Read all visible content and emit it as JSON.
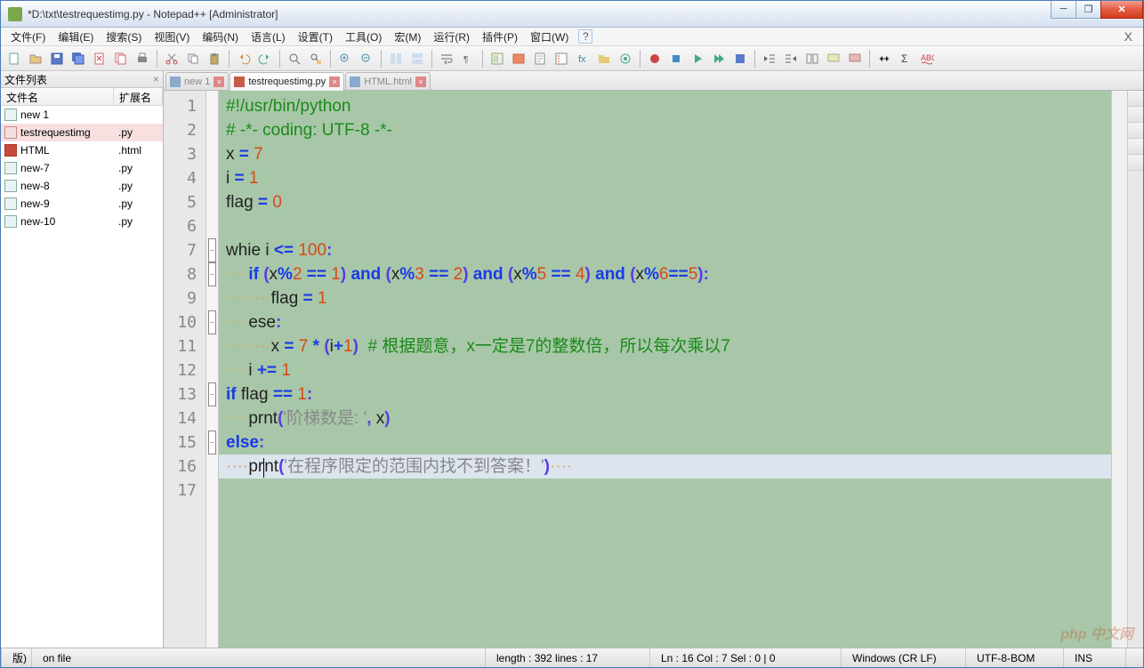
{
  "window": {
    "title": "*D:\\txt\\testrequestimg.py - Notepad++ [Administrator]"
  },
  "menus": [
    "文件(F)",
    "编辑(E)",
    "搜索(S)",
    "视图(V)",
    "编码(N)",
    "语言(L)",
    "设置(T)",
    "工具(O)",
    "宏(M)",
    "运行(R)",
    "插件(P)",
    "窗口(W)"
  ],
  "sidebar": {
    "title": "文件列表",
    "columns": {
      "name": "文件名",
      "ext": "扩展名"
    },
    "files": [
      {
        "name": "new 1",
        "ext": "",
        "kind": "plain"
      },
      {
        "name": "testrequestimg",
        "ext": ".py",
        "kind": "active"
      },
      {
        "name": "HTML",
        "ext": ".html",
        "kind": "html"
      },
      {
        "name": "new-7",
        "ext": ".py",
        "kind": "plain"
      },
      {
        "name": "new-8",
        "ext": ".py",
        "kind": "plain"
      },
      {
        "name": "new-9",
        "ext": ".py",
        "kind": "plain"
      },
      {
        "name": "new-10",
        "ext": ".py",
        "kind": "plain"
      }
    ]
  },
  "tabs": [
    {
      "label": "new 1",
      "active": false
    },
    {
      "label": "testrequestimg.py",
      "active": true
    },
    {
      "label": "HTML.html",
      "active": false
    }
  ],
  "code": {
    "lines": [
      {
        "n": 1,
        "fold": "",
        "html": "<span class='tok-comment'>#!/usr/bin/python</span>"
      },
      {
        "n": 2,
        "fold": "",
        "html": "<span class='tok-comment'># -*- coding: UTF-8 -*-</span>"
      },
      {
        "n": 3,
        "fold": "",
        "html": "<span class='tok-ident'>x</span> <span class='tok-op'>=</span> <span class='tok-num'>7</span>"
      },
      {
        "n": 4,
        "fold": "",
        "html": "<span class='tok-ident'>i</span> <span class='tok-op'>=</span> <span class='tok-num'>1</span>"
      },
      {
        "n": 5,
        "fold": "",
        "html": "<span class='tok-ident'>flag</span> <span class='tok-op'>=</span> <span class='tok-num'>0</span>"
      },
      {
        "n": 6,
        "fold": "",
        "html": ""
      },
      {
        "n": 7,
        "fold": "-",
        "html": "<span class='tok-ident'>whie</span> <span class='tok-ident'>i</span> <span class='tok-op'>&lt;=</span> <span class='tok-num'>100</span><span class='tok-paren'>:</span>"
      },
      {
        "n": 8,
        "fold": "-",
        "html": "<span class='ws'>····</span><span class='tok-keyword'>if</span> <span class='tok-paren'>(</span><span class='tok-ident'>x</span><span class='tok-op'>%</span><span class='tok-num'>2</span> <span class='tok-op'>==</span> <span class='tok-num'>1</span><span class='tok-paren'>)</span> <span class='tok-keyword'>and</span> <span class='tok-paren'>(</span><span class='tok-ident'>x</span><span class='tok-op'>%</span><span class='tok-num'>3</span> <span class='tok-op'>==</span> <span class='tok-num'>2</span><span class='tok-paren'>)</span> <span class='tok-keyword'>and</span> <span class='tok-paren'>(</span><span class='tok-ident'>x</span><span class='tok-op'>%</span><span class='tok-num'>5</span> <span class='tok-op'>==</span> <span class='tok-num'>4</span><span class='tok-paren'>)</span> <span class='tok-keyword'>and</span> <span class='tok-paren'>(</span><span class='tok-ident'>x</span><span class='tok-op'>%</span><span class='tok-num'>6</span><span class='tok-op'>==</span><span class='tok-num'>5</span><span class='tok-paren'>)</span><span class='tok-paren'>:</span>"
      },
      {
        "n": 9,
        "fold": "",
        "html": "<span class='ws'>········</span><span class='tok-ident'>flag</span> <span class='tok-op'>=</span> <span class='tok-num'>1</span>"
      },
      {
        "n": 10,
        "fold": "-",
        "html": "<span class='ws'>····</span><span class='tok-ident'>ese</span><span class='tok-paren'>:</span>"
      },
      {
        "n": 11,
        "fold": "",
        "html": "<span class='ws'>········</span><span class='tok-ident'>x</span> <span class='tok-op'>=</span> <span class='tok-num'>7</span> <span class='tok-op'>*</span> <span class='tok-paren'>(</span><span class='tok-ident'>i</span><span class='tok-op'>+</span><span class='tok-num'>1</span><span class='tok-paren'>)</span>  <span class='tok-comment'># 根据题意，x一定是7的整数倍，所以每次乘以7</span>"
      },
      {
        "n": 12,
        "fold": "",
        "html": "<span class='ws'>····</span><span class='tok-ident'>i</span> <span class='tok-op'>+=</span> <span class='tok-num'>1</span>"
      },
      {
        "n": 13,
        "fold": "-",
        "html": "<span class='tok-keyword'>if</span> <span class='tok-ident'>flag</span> <span class='tok-op'>==</span> <span class='tok-num'>1</span><span class='tok-paren'>:</span>"
      },
      {
        "n": 14,
        "fold": "",
        "html": "<span class='ws'>····</span><span class='tok-ident'>prnt</span><span class='tok-paren'>(</span><span class='tok-str'>'阶梯数是: '</span><span class='tok-paren'>,</span> <span class='tok-ident'>x</span><span class='tok-paren'>)</span>"
      },
      {
        "n": 15,
        "fold": "-",
        "html": "<span class='tok-keyword'>else</span><span class='tok-paren'>:</span>"
      },
      {
        "n": 16,
        "fold": "",
        "current": true,
        "html": "<span class='ws'>····</span><span class='tok-ident'>pr<span class='caret'></span>nt</span><span class='tok-paren'>(</span><span class='tok-str'>'在程序限定的范围内找不到答案！'</span><span class='tok-paren'>)</span><span class='ws'>····</span>"
      },
      {
        "n": 17,
        "fold": "",
        "html": ""
      }
    ]
  },
  "status": {
    "tag": "版)",
    "file": "on file",
    "stats": "length : 392     lines : 17",
    "pos": "Ln : 16    Col : 7    Sel : 0 | 0",
    "eol": "Windows (CR LF)",
    "enc": "UTF-8-BOM",
    "ins": "INS"
  },
  "watermark": "php 中文网"
}
